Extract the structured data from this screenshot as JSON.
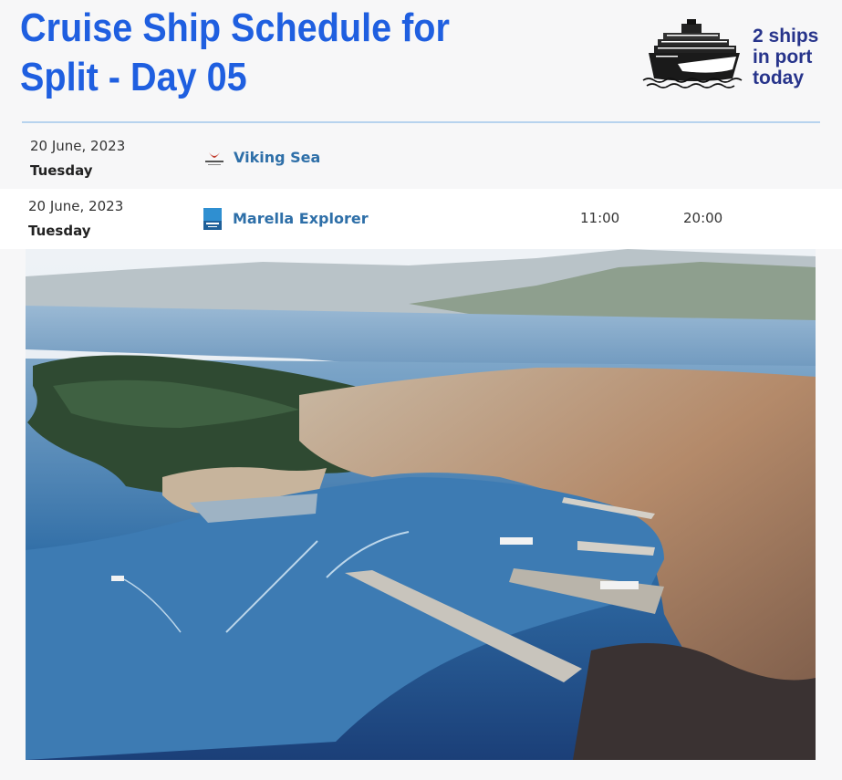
{
  "header": {
    "title_line1": "Cruise Ship Schedule for",
    "title_line2": "Split - Day 05",
    "ships_line1": "2 ships",
    "ships_line2": "in port",
    "ships_line3": "today"
  },
  "schedule": [
    {
      "date": "20 June, 2023",
      "day": "Tuesday",
      "ship": "Viking Sea",
      "logo": "viking-logo",
      "arrival": "",
      "departure": ""
    },
    {
      "date": "20 June, 2023",
      "day": "Tuesday",
      "ship": "Marella Explorer",
      "logo": "marella-logo",
      "arrival": "11:00",
      "departure": "20:00"
    }
  ],
  "colors": {
    "title": "#1f5fe0",
    "badge_text": "#27348b",
    "link": "#2e6fa8",
    "divider": "#b7d3ee"
  }
}
